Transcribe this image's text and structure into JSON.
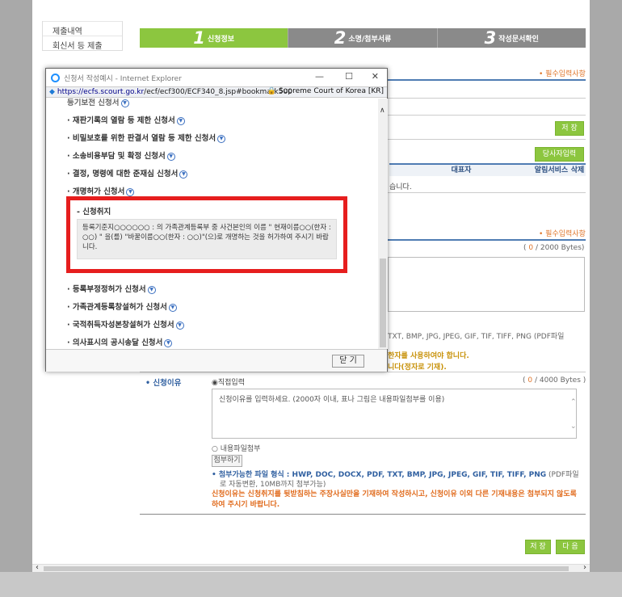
{
  "leftnav": {
    "items": [
      "제출내역",
      "회신서 등 제출"
    ]
  },
  "steps": [
    {
      "num": "1",
      "label": "신청정보"
    },
    {
      "num": "2",
      "label": "소명/첨부서류"
    },
    {
      "num": "3",
      "label": "작성문서확인"
    }
  ],
  "main": {
    "required_note": "• 필수입력사항",
    "required_note2": "• 필수입력사항",
    "save_button": "저 장",
    "party_button": "당사자입력",
    "col_rep": "대표자",
    "col_alert": "알림서비스",
    "col_delete": "삭제",
    "row_text": "습니다.",
    "bytes_counter_prefix": "( ",
    "bytes_counter_value": "0",
    "bytes_counter_suffix": " / 2000 Bytes)",
    "file_formats_partial": "TXT, BMP, JPG, JPEG, GIF, TIF, TIFF, PNG (PDF파일",
    "warn1": "한자를 사용하여야 합니다.",
    "warn2": "니다(정자로 기재).",
    "reason_label": "• 신청이유",
    "radio_direct": "직접입력",
    "counter2_prefix": "( ",
    "counter2_value": "0",
    "counter2_suffix": " / 4000 Bytes )",
    "reason_placeholder": "신청이유를 입력하세요. (2000자 이내, 표나 그림은 내용파일첨부를 이용)",
    "radio_file": "내용파일첨부",
    "attach_button": "첨부하기",
    "formats_label": "• 첨부가능한 파일 형식 : ",
    "formats": "HWP, DOC, DOCX, PDF, TXT, BMP, JPG, JPEG, GIF, TIF, TIFF, PNG",
    "formats_tail": " (PDF파일",
    "formats_line2": "로 자동변환, 10MB까지 첨부가능)",
    "reason_warning": "신청이유는 신청취지를 뒷받침하는 주장사실만을 기재하여 작성하시고, 신청이유 이외 다른 기재내용은 첨부되지 않도록 하여 주시기 바랍니다.",
    "bottom_save": "저 장",
    "bottom_next": "다 음"
  },
  "popup": {
    "title": "신청서 작성예시 - Internet Explorer",
    "url_host": "https://ecfs.scourt.go.kr",
    "url_path": "/ecf/ecf300/ECF340_8.jsp#bookmark500",
    "cert": "Supreme Court of Korea [KR]",
    "top_item": "등기보전 신청서",
    "items_before": [
      "재판기록의 열람 등 제한 신청서",
      "비밀보호를 위한 판결서 열람 등 제한 신청서",
      "소송비용부담 및 확정 신청서",
      "결정, 명령에 대한 준재심 신청서",
      "개명허가 신청서"
    ],
    "box_title": "- 신청취지",
    "box_text": "등록기준지○○○○○○ : 의 가족관계등록부 중 사건본인의 이름 \" 현재이름○○(한자 : ○○) \" 을(를) \"바꿀이름○○(한자 : ○○)\"(으)로 개명하는 것을 허가하여 주시기 바랍니다.",
    "items_after": [
      "등록부정정허가 신청서",
      "가족관계등록창설허가 신청서",
      "국적취득자성본창설허가 신청서",
      "의사표시의 공시송달 신청서"
    ],
    "close_button": "닫 기"
  }
}
